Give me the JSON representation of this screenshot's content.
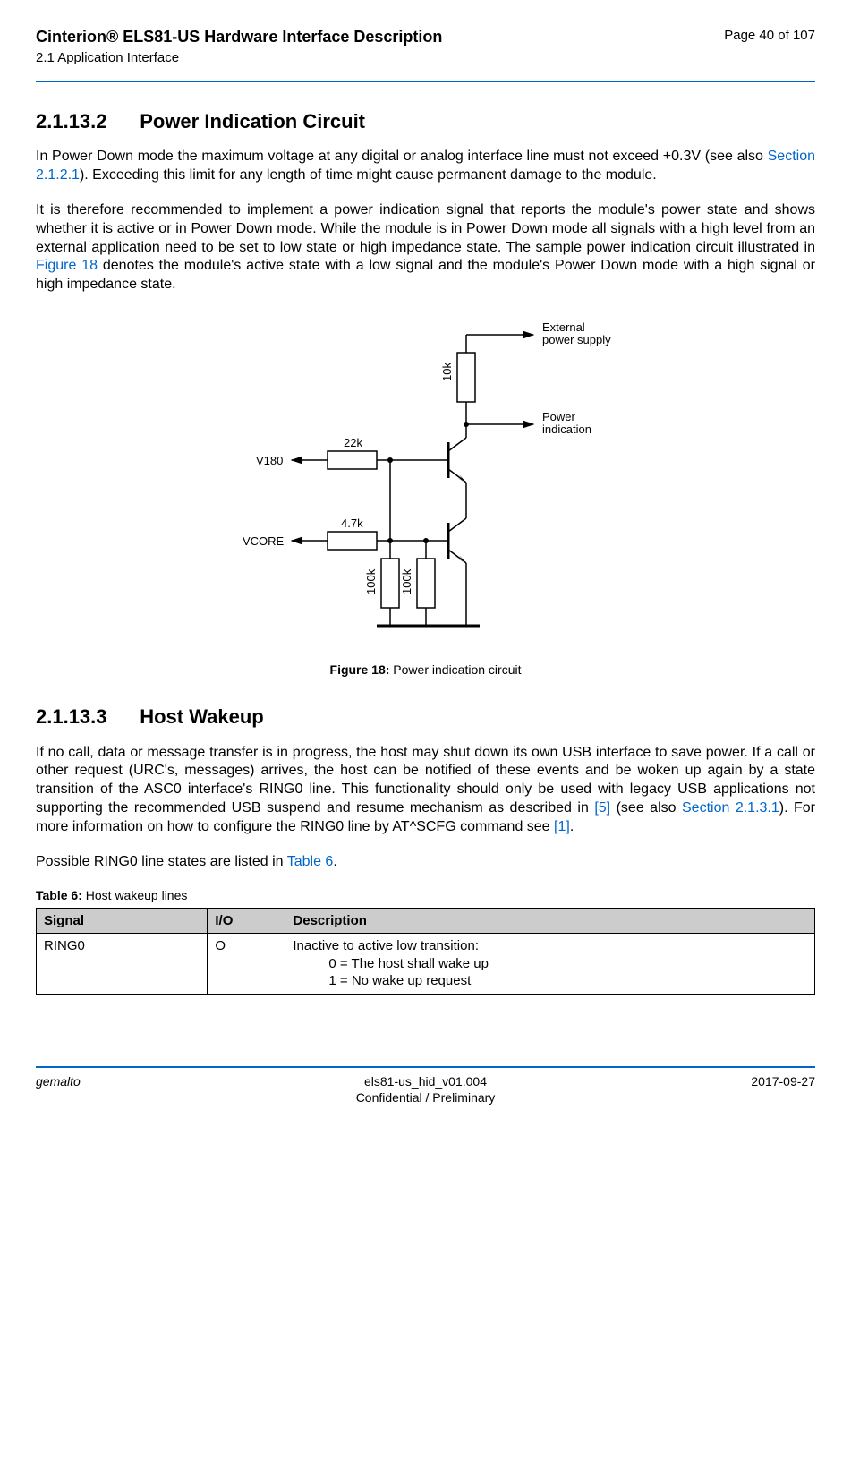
{
  "header": {
    "title": "Cinterion® ELS81-US Hardware Interface Description",
    "subtitle": "2.1 Application Interface",
    "page": "Page 40 of 107"
  },
  "section_a": {
    "number": "2.1.13.2",
    "title": "Power Indication Circuit",
    "para1_a": "In Power Down mode the maximum voltage at any digital or analog interface line must not exceed +0.3V (see also ",
    "para1_link": "Section 2.1.2.1",
    "para1_b": "). Exceeding this limit for any length of time might cause permanent damage to the module.",
    "para2_a": "It is therefore recommended to implement a power indication signal that reports the module's power state and shows whether it is active or in Power Down mode. While the module is in Power Down mode all signals with a high level from an external application need to be set to low state or high impedance state. The sample power indication circuit illustrated in ",
    "para2_link": "Figure 18",
    "para2_b": " denotes the module's active state with a low signal and the module's Power Down mode with a high signal or high impedance state."
  },
  "figure": {
    "label_ext1": "External",
    "label_ext2": "power supply",
    "label_power1": "Power",
    "label_power2": "indication",
    "r_10k": "10k",
    "r_22k": "22k",
    "r_47k": "4.7k",
    "r_100k_a": "100k",
    "r_100k_b": "100k",
    "v180": "V180",
    "vcore": "VCORE",
    "caption_bold": "Figure 18:",
    "caption_text": "  Power indication circuit"
  },
  "section_b": {
    "number": "2.1.13.3",
    "title": "Host Wakeup",
    "para1_a": "If no call, data or message transfer is in progress, the host may shut down its own USB interface to save power. If a call or other request (URC's, messages) arrives, the host can be notified of these events and be woken up again by a state transition of the ASC0 interface's RING0 line. This functionality should only be used with legacy USB applications not supporting the recommended USB suspend and resume mechanism as described in ",
    "para1_link1": "[5]",
    "para1_b": " (see also ",
    "para1_link2": "Section 2.1.3.1",
    "para1_c": "). For more information on how to configure the RING0 line by AT^SCFG command see ",
    "para1_link3": "[1]",
    "para1_d": ".",
    "para2_a": "Possible RING0 line states are listed in ",
    "para2_link": "Table 6",
    "para2_b": "."
  },
  "table": {
    "caption_bold": "Table 6:",
    "caption_text": "  Host wakeup lines",
    "h1": "Signal",
    "h2": "I/O",
    "h3": "Description",
    "r1c1": "RING0",
    "r1c2": "O",
    "r1c3_l1": "Inactive to active low transition:",
    "r1c3_l2": "0 = The host shall wake up",
    "r1c3_l3": "1 = No wake up request"
  },
  "footer": {
    "left": "gemalto",
    "center1": "els81-us_hid_v01.004",
    "center2": "Confidential / Preliminary",
    "right": "2017-09-27"
  }
}
